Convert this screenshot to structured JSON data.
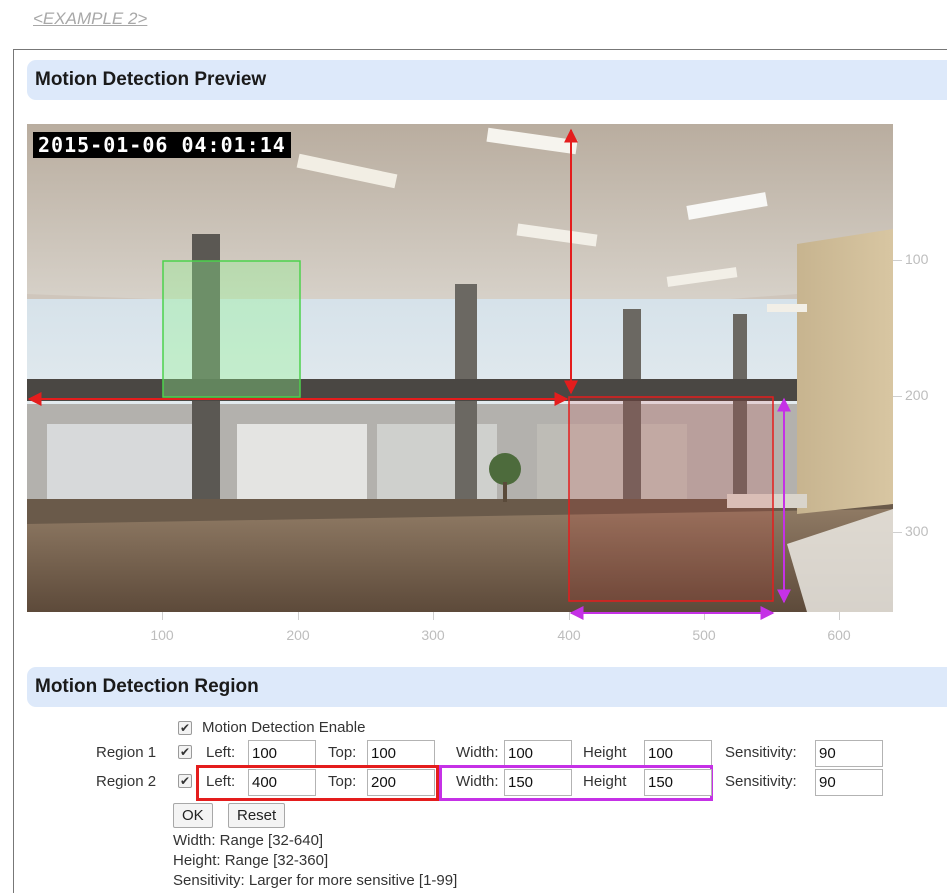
{
  "example_label": "<EXAMPLE 2>",
  "preview": {
    "title": "Motion Detection Preview",
    "timestamp": "2015-01-06 04:01:14",
    "axis_x_labels": [
      "100",
      "200",
      "300",
      "400",
      "500",
      "600"
    ],
    "axis_y_labels": [
      "100",
      "200",
      "300"
    ]
  },
  "region_section": {
    "title": "Motion Detection Region",
    "enable_label": "Motion Detection Enable",
    "field_labels": {
      "left": "Left:",
      "top": "Top:",
      "width": "Width:",
      "height": "Height",
      "sensitivity": "Sensitivity:"
    },
    "region1": {
      "label": "Region 1",
      "left": "100",
      "top": "100",
      "width": "100",
      "height": "100",
      "sensitivity": "90"
    },
    "region2": {
      "label": "Region 2",
      "left": "400",
      "top": "200",
      "width": "150",
      "height": "150",
      "sensitivity": "90"
    },
    "ok_label": "OK",
    "reset_label": "Reset",
    "hints": {
      "width": "Width: Range [32-640]",
      "height": "Height: Range [32-360]",
      "sensitivity": "Sensitivity: Larger for more sensitive [1-99]"
    }
  },
  "colors": {
    "header_bg": "#dde9fa",
    "annotation_red": "#e41d1d",
    "annotation_magenta": "#c531e6",
    "region1_green": "#4cd24c"
  }
}
